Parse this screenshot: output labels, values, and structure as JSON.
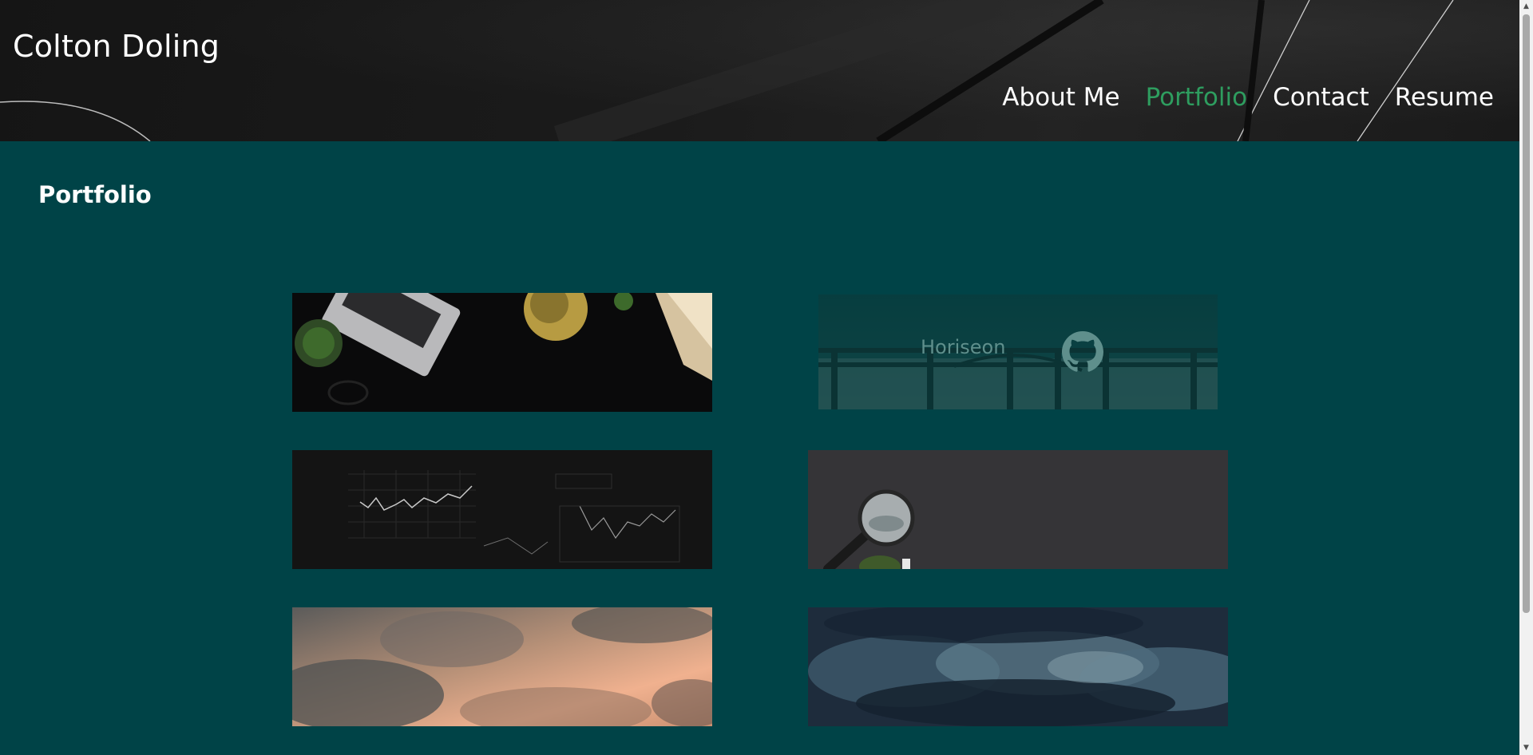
{
  "header": {
    "site_title": "Colton Doling",
    "nav": [
      {
        "label": "About Me",
        "active": false
      },
      {
        "label": "Portfolio",
        "active": true
      },
      {
        "label": "Contact",
        "active": false
      },
      {
        "label": "Resume",
        "active": false
      }
    ],
    "active_color": "#2e9d5f"
  },
  "main": {
    "title": "Portfolio",
    "projects": [
      {
        "image": "desk-laptop-globe-image"
      },
      {
        "image": "bridge-railing-image",
        "label": "Horiseon",
        "icon": "github-icon",
        "state": "hover"
      },
      {
        "image": "stock-charts-image"
      },
      {
        "image": "magnifying-glass-image"
      },
      {
        "image": "sunset-clouds-image"
      },
      {
        "image": "storm-clouds-image"
      }
    ]
  },
  "colors": {
    "background": "#004347",
    "header": "#1a1a1a",
    "text": "#ffffff"
  }
}
